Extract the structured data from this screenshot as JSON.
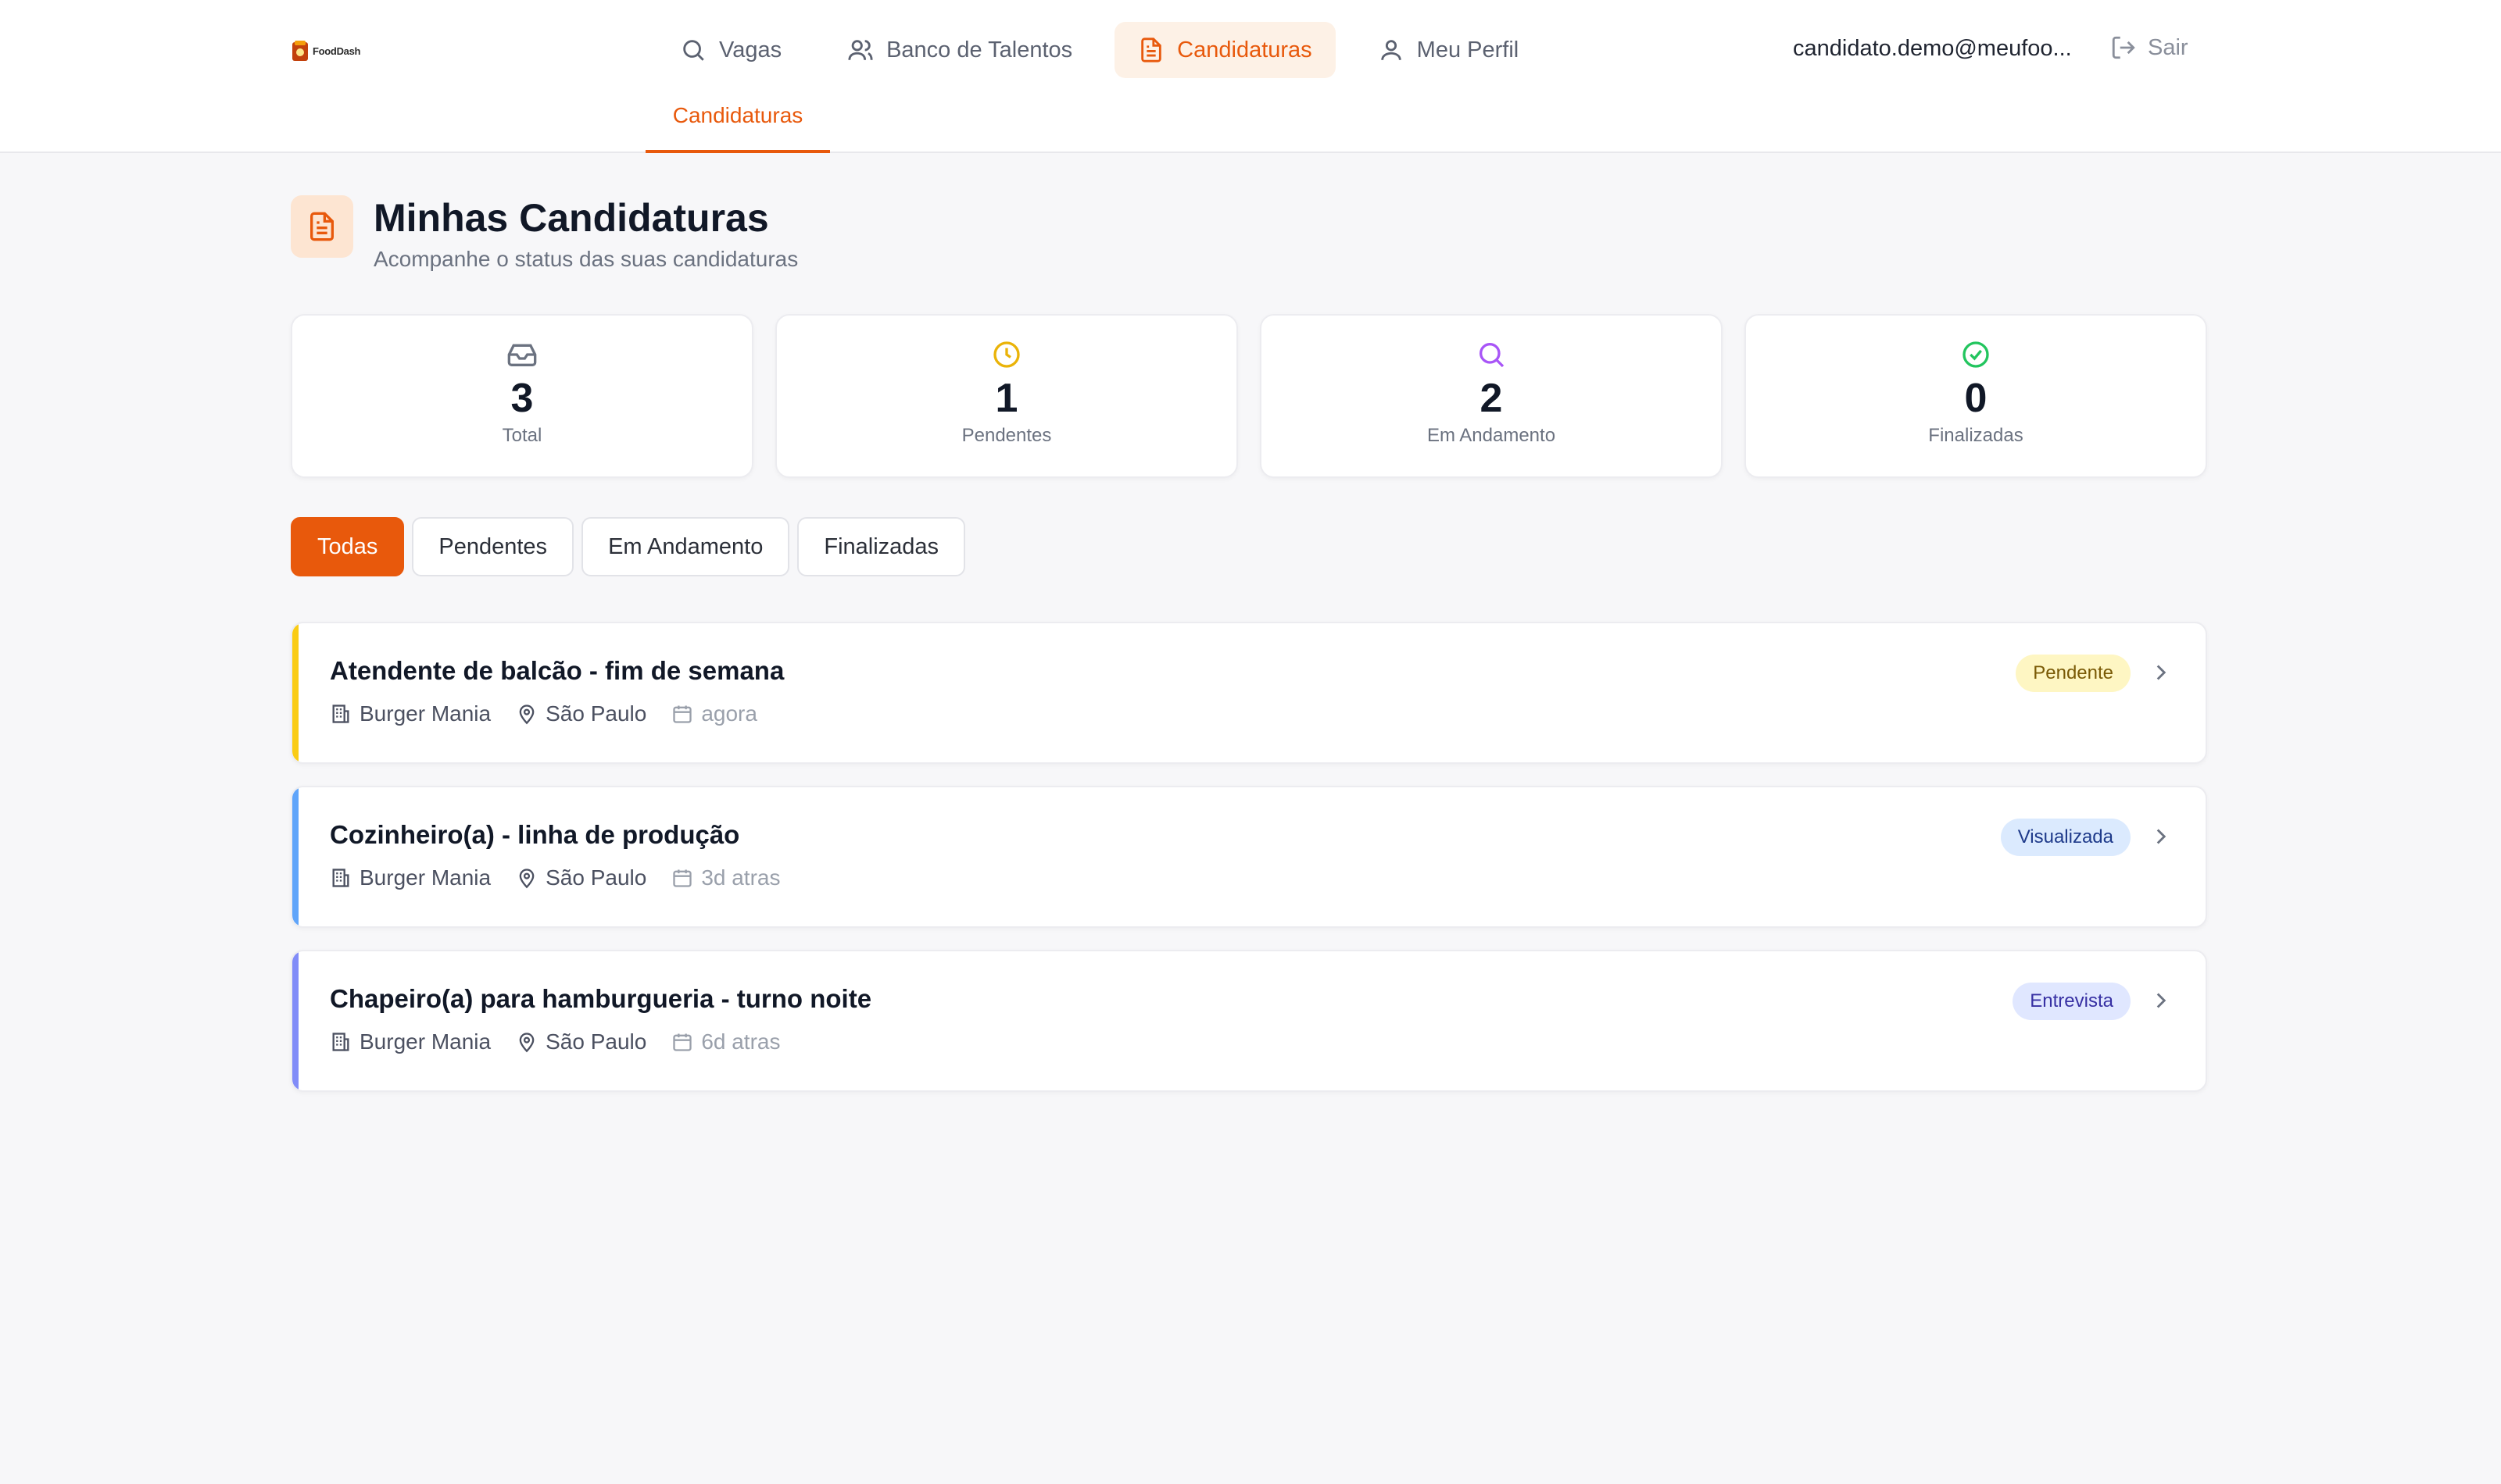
{
  "app": {
    "logo_text": "FoodDash"
  },
  "nav": {
    "items": [
      {
        "label": "Vagas",
        "icon": "search-icon"
      },
      {
        "label": "Banco de Talentos",
        "icon": "users-icon"
      },
      {
        "label": "Candidaturas",
        "icon": "document-icon",
        "active": true
      },
      {
        "label": "Meu Perfil",
        "icon": "user-icon"
      }
    ],
    "user_email": "candidato.demo@meufoo...",
    "logout_label": "Sair",
    "subnav_label": "Candidaturas"
  },
  "page": {
    "title": "Minhas Candidaturas",
    "subtitle": "Acompanhe o status das suas candidaturas"
  },
  "stats": [
    {
      "value": "3",
      "label": "Total",
      "icon": "inbox-icon",
      "color": "#6b7280"
    },
    {
      "value": "1",
      "label": "Pendentes",
      "icon": "clock-icon",
      "color": "#eab308"
    },
    {
      "value": "2",
      "label": "Em Andamento",
      "icon": "search-icon",
      "color": "#a855f7"
    },
    {
      "value": "0",
      "label": "Finalizadas",
      "icon": "check-circle-icon",
      "color": "#22c55e"
    }
  ],
  "filters": [
    {
      "label": "Todas",
      "active": true
    },
    {
      "label": "Pendentes"
    },
    {
      "label": "Em Andamento"
    },
    {
      "label": "Finalizadas"
    }
  ],
  "applications": [
    {
      "title": "Atendente de balcão - fim de semana",
      "company": "Burger Mania",
      "city": "São Paulo",
      "date": "agora",
      "status": "Pendente",
      "accent": "#facc15",
      "badge_bg": "#fef6c3",
      "badge_color": "#7a5a06"
    },
    {
      "title": "Cozinheiro(a) - linha de produção",
      "company": "Burger Mania",
      "city": "São Paulo",
      "date": "3d atras",
      "status": "Visualizada",
      "accent": "#60a5fa",
      "badge_bg": "#dbeafe",
      "badge_color": "#1e3a8a"
    },
    {
      "title": "Chapeiro(a) para hamburgueria - turno noite",
      "company": "Burger Mania",
      "city": "São Paulo",
      "date": "6d atras",
      "status": "Entrevista",
      "accent": "#818cf8",
      "badge_bg": "#e0e7ff",
      "badge_color": "#3730a3"
    }
  ]
}
